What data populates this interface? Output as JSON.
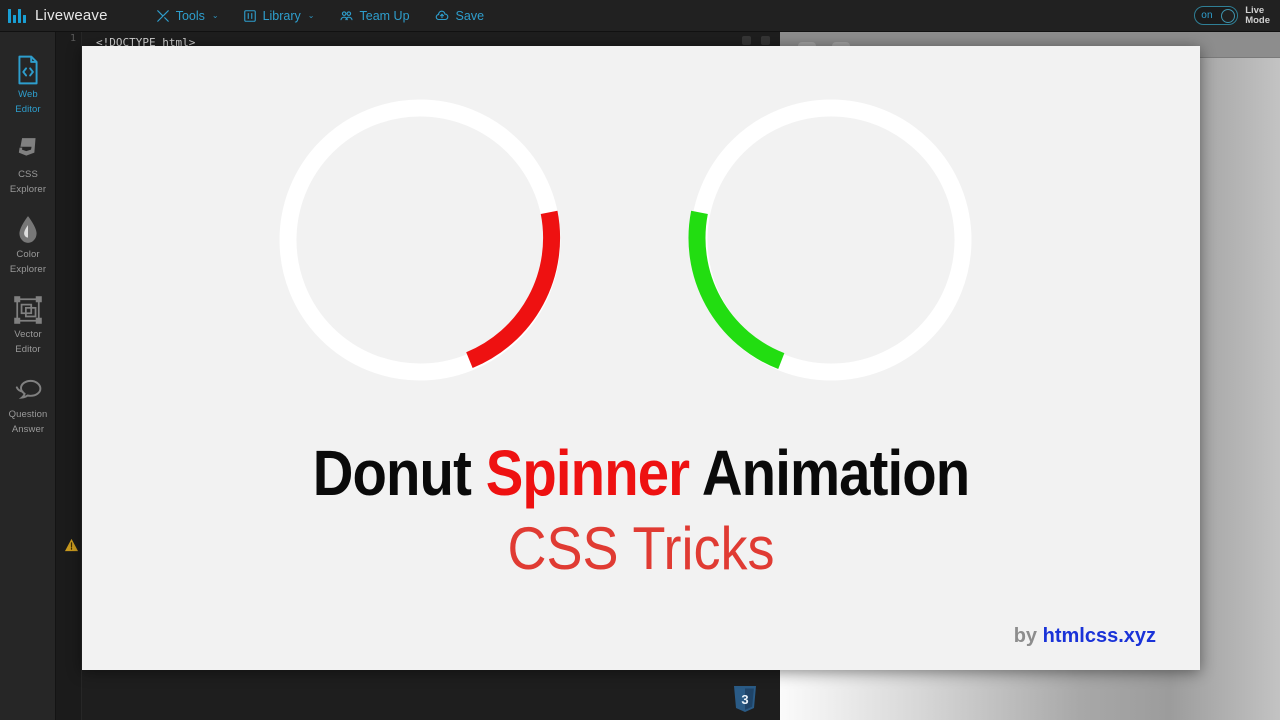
{
  "app": {
    "brand": "Liveweave",
    "logo_icon": "bar-chart-logo-icon"
  },
  "topbar": {
    "menus": [
      {
        "label": "Tools",
        "icon": "tools-icon",
        "caret": "⌄"
      },
      {
        "label": "Library",
        "icon": "library-icon",
        "caret": "⌄"
      },
      {
        "label": "Team Up",
        "icon": "team-up-icon",
        "caret": ""
      },
      {
        "label": "Save",
        "icon": "cloud-save-icon",
        "caret": ""
      }
    ],
    "live_mode": {
      "state_label": "on",
      "label_line1": "Live",
      "label_line2": "Mode",
      "accent": "#2e9ecd"
    }
  },
  "sidebar": {
    "items": [
      {
        "label_line1": "Web",
        "label_line2": "Editor",
        "icon": "code-file-icon",
        "active": true
      },
      {
        "label_line1": "CSS",
        "label_line2": "Explorer",
        "icon": "css3-icon",
        "active": false
      },
      {
        "label_line1": "Color",
        "label_line2": "Explorer",
        "icon": "color-droplet-icon",
        "active": false
      },
      {
        "label_line1": "Vector",
        "label_line2": "Editor",
        "icon": "vector-shapes-icon",
        "active": false
      },
      {
        "label_line1": "Question",
        "label_line2": "Answer",
        "icon": "chat-bubbles-icon",
        "active": false
      }
    ]
  },
  "editor": {
    "lines": [
      {
        "number": "1",
        "text": "<!DOCTYPE html>"
      }
    ],
    "warning_icon": "warning-triangle-icon",
    "css_badge_icon": "css3-shield-icon"
  },
  "preview": {
    "spinners": [
      {
        "name": "red-donut-spinner",
        "color": "#ee1111",
        "track": "#ffffff",
        "arc_start_deg": -12,
        "arc_end_deg": 68
      },
      {
        "name": "green-donut-spinner",
        "color": "#22dd11",
        "track": "#ffffff",
        "arc_start_deg": 168,
        "arc_end_deg": 248
      }
    ],
    "headline": {
      "part1": "Donut ",
      "accent": "Spinner",
      "part2": " Animation"
    },
    "subtitle": "CSS Tricks",
    "credit": {
      "prefix": "by ",
      "site": "htmlcss.xyz"
    }
  }
}
